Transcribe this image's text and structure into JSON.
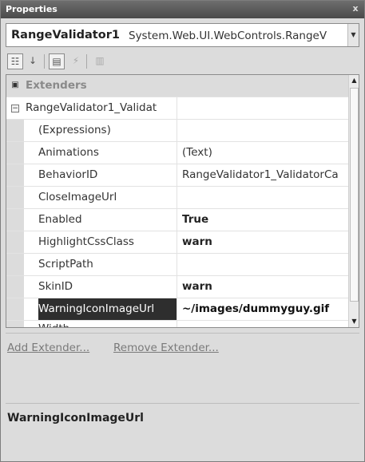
{
  "window": {
    "title": "Properties",
    "close_glyph": "x"
  },
  "object_selector": {
    "name": "RangeValidator1",
    "type": "System.Web.UI.WebControls.RangeV"
  },
  "toolbar": {
    "categorized_glyph": "☷",
    "alphabetical_glyph": "↓",
    "properties_glyph": "▤",
    "events_glyph": "⚡",
    "pages_glyph": "▥"
  },
  "grid": {
    "category": {
      "label": "Extenders",
      "state": "collapsed",
      "glyph": "⊟"
    },
    "group": {
      "label": "RangeValidator1_Validat",
      "glyph": "⊟"
    },
    "rows": [
      {
        "name": "(Expressions)",
        "value": "",
        "bold": false
      },
      {
        "name": "Animations",
        "value": "(Text)",
        "bold": false
      },
      {
        "name": "BehaviorID",
        "value": "RangeValidator1_ValidatorCa",
        "bold": false
      },
      {
        "name": "CloseImageUrl",
        "value": "",
        "bold": false
      },
      {
        "name": "Enabled",
        "value": "True",
        "bold": true
      },
      {
        "name": "HighlightCssClass",
        "value": "warn",
        "bold": true
      },
      {
        "name": "ScriptPath",
        "value": "",
        "bold": false
      },
      {
        "name": "SkinID",
        "value": "warn",
        "bold": true
      },
      {
        "name": "WarningIconImageUrl",
        "value": "~/images/dummyguy.gif",
        "bold": true,
        "selected": true
      },
      {
        "name": "Width",
        "value": "",
        "bold": false
      }
    ]
  },
  "commands": {
    "add_extender": "Add Extender...",
    "remove_extender": "Remove Extender..."
  },
  "description": {
    "title": "WarningIconImageUrl"
  }
}
